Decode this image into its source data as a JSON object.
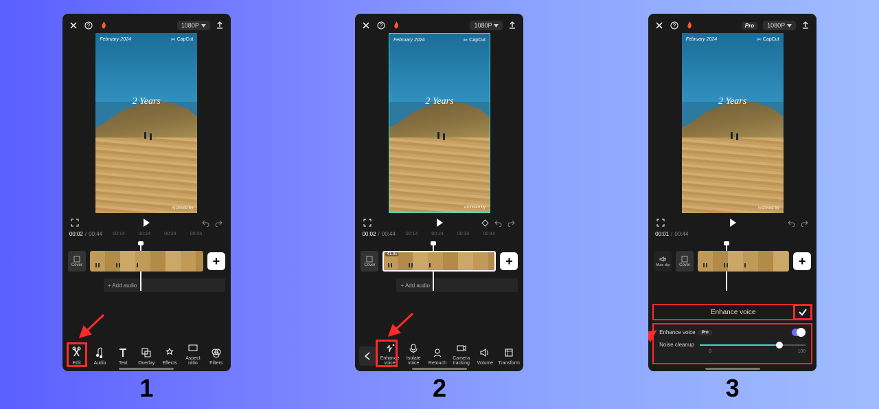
{
  "steps": [
    "1",
    "2",
    "3"
  ],
  "topbar": {
    "resolution": "1080P",
    "pro": "Pro"
  },
  "preview": {
    "date": "February 2024",
    "watermark": "CapCut",
    "overlay": "2 Years",
    "archived": "Archived by"
  },
  "time": {
    "current_1": "00:02",
    "current_2": "00:02",
    "current_3": "00:01",
    "total": "00:44",
    "marks": [
      "00:14",
      "00:24",
      "00:34",
      "00:44"
    ]
  },
  "timeline": {
    "cover": "Cover",
    "mute": "Mute clip",
    "add_audio": "+ Add audio",
    "clip_dur": "41.9s"
  },
  "toolbar1": [
    {
      "key": "edit",
      "label": "Edit"
    },
    {
      "key": "audio",
      "label": "Audio"
    },
    {
      "key": "text",
      "label": "Text"
    },
    {
      "key": "overlay",
      "label": "Overlay"
    },
    {
      "key": "effects",
      "label": "Effects"
    },
    {
      "key": "aspect",
      "label": "Aspect ratio"
    },
    {
      "key": "filters",
      "label": "Filters"
    }
  ],
  "toolbar2": [
    {
      "key": "enhancevoice",
      "label": "Enhance voice"
    },
    {
      "key": "isolatevoice",
      "label": "Isolate voice"
    },
    {
      "key": "retouch",
      "label": "Retouch"
    },
    {
      "key": "camtrack",
      "label": "Camera tracking"
    },
    {
      "key": "volume",
      "label": "Volume"
    },
    {
      "key": "transform",
      "label": "Transform"
    }
  ],
  "enhance": {
    "title": "Enhance voice",
    "label": "Enhance voice",
    "pro": "Pro",
    "noise_label": "Noise cleanup",
    "slider_min": "0",
    "slider_max": "100"
  }
}
